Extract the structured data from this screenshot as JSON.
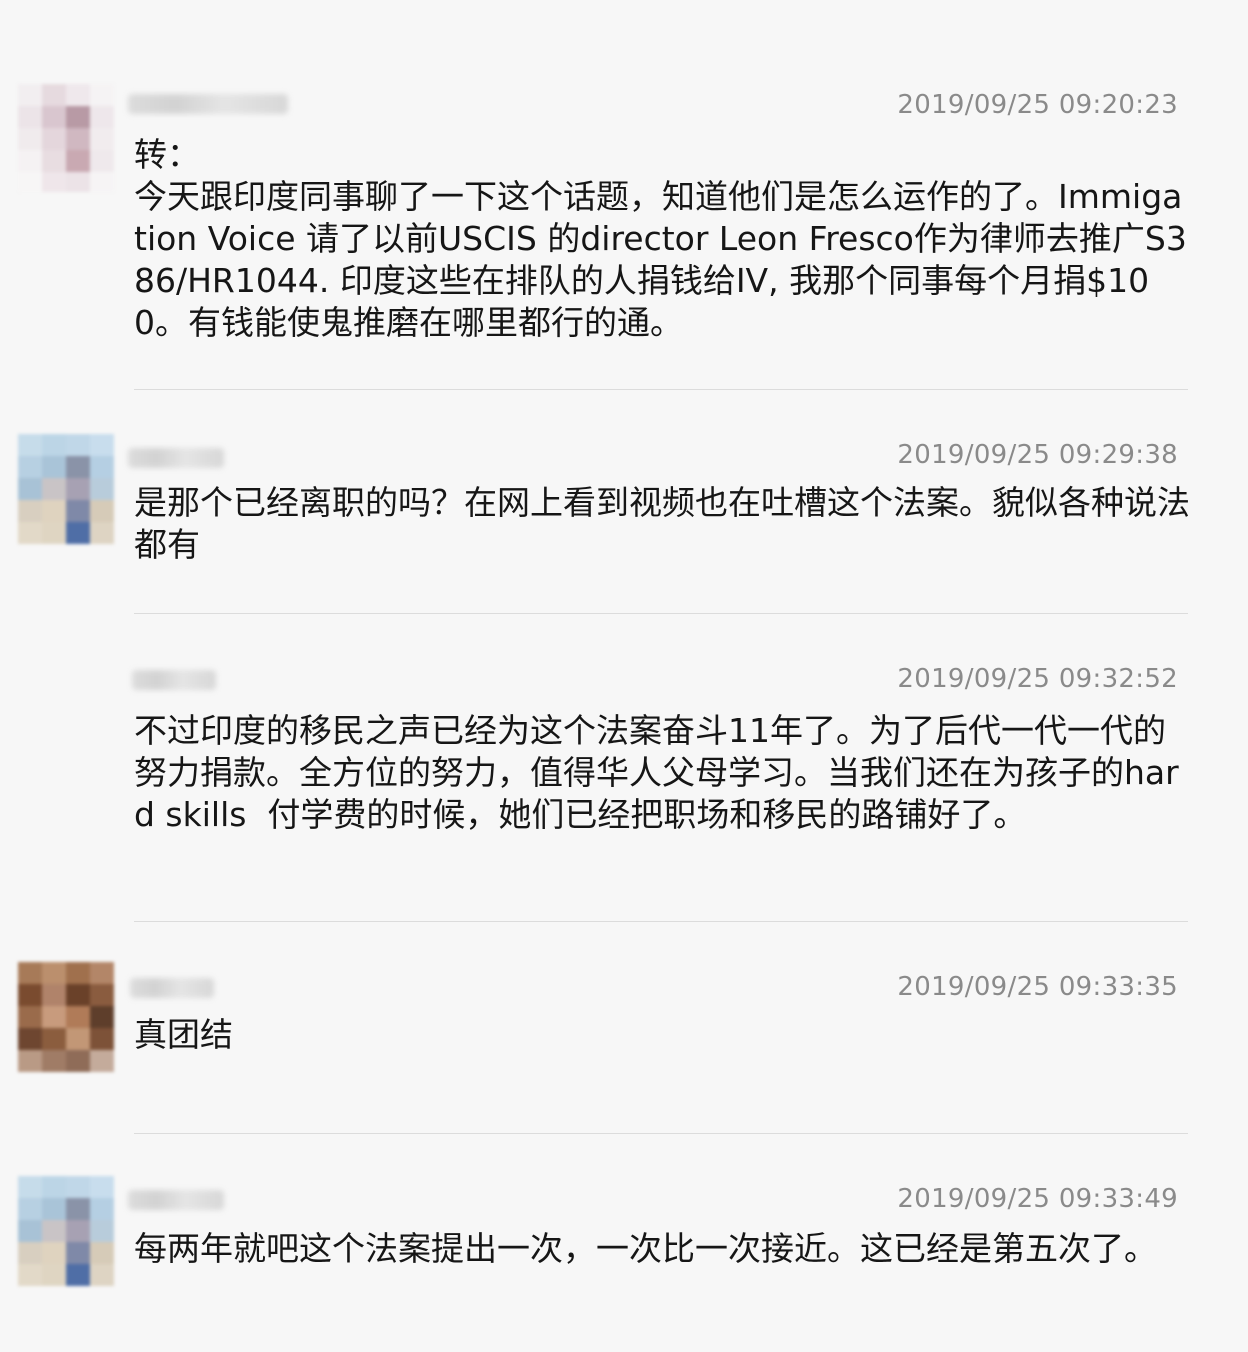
{
  "messages": [
    {
      "timestamp": "2019/09/25 09:20:23",
      "text": "转：\n今天跟印度同事聊了一下这个话题，知道他们是怎么运作的了。Immigation Voice 请了以前USCIS 的director Leon Fresco作为律师去推广S386/HR1044. 印度这些在排队的人捐钱给IV, 我那个同事每个月捐$100。有钱能使鬼推磨在哪里都行的通。",
      "avatar_icon": "blurred-user-avatar-icon"
    },
    {
      "timestamp": "2019/09/25 09:29:38",
      "text": "是那个已经离职的吗？在网上看到视频也在吐槽这个法案。貌似各种说法都有",
      "avatar_icon": "blurred-user-avatar-icon"
    },
    {
      "timestamp": "2019/09/25 09:32:52",
      "text": "不过印度的移民之声已经为这个法案奋斗11年了。为了后代一代一代的努力捐款。全方位的努力，值得华人父母学习。当我们还在为孩子的hard skills  付学费的时候，她们已经把职场和移民的路铺好了。",
      "avatar_icon": null
    },
    {
      "timestamp": "2019/09/25 09:33:35",
      "text": "真团结",
      "avatar_icon": "blurred-user-avatar-icon"
    },
    {
      "timestamp": "2019/09/25 09:33:49",
      "text": "每两年就吧这个法案提出一次，一次比一次接近。这已经是第五次了。",
      "avatar_icon": "blurred-user-avatar-icon"
    }
  ],
  "colors": {
    "background": "#f7f7f7",
    "text": "#161616",
    "timestamp": "#8a8a8a",
    "divider": "#dcdcdc"
  }
}
